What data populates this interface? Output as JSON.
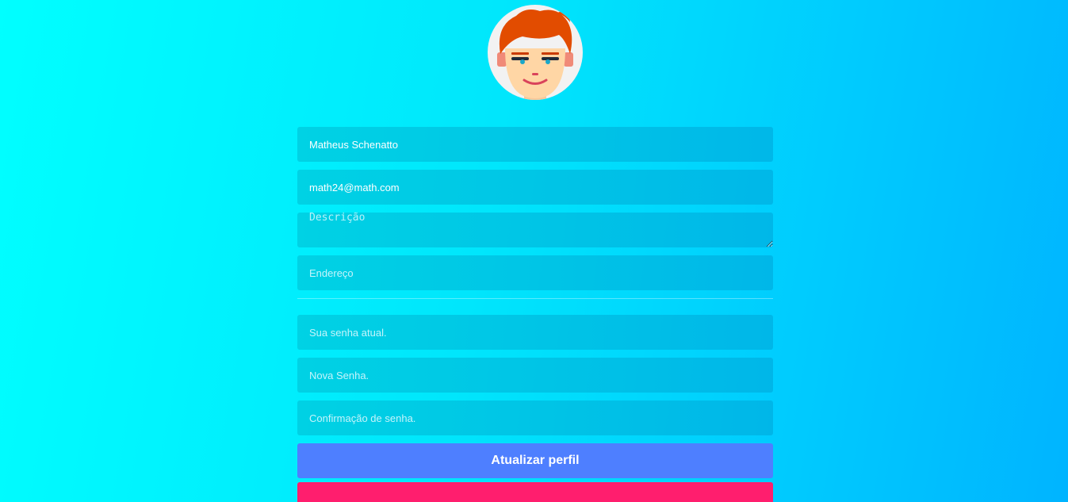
{
  "profile": {
    "avatar_icon": "boy-redhead-avatar-icon"
  },
  "form": {
    "name_value": "Matheus Schenatto",
    "email_value": "math24@math.com",
    "description_placeholder": "Descrição",
    "address_placeholder": "Endereço",
    "current_password_placeholder": "Sua senha atual.",
    "new_password_placeholder": "Nova Senha.",
    "confirm_password_placeholder": "Confirmação de senha.",
    "update_button_label": "Atualizar perfil",
    "second_button_label": ""
  },
  "colors": {
    "update_button": "#4e7fff",
    "second_button": "#ff1e6e"
  }
}
